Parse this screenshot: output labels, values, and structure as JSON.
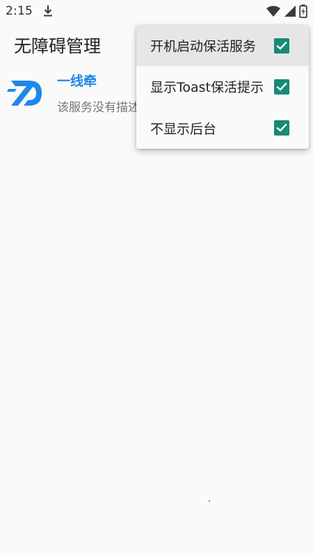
{
  "status_bar": {
    "time": "2:15",
    "icons": [
      "download-icon",
      "wifi-icon",
      "signal-icon",
      "battery-charging-icon"
    ]
  },
  "app_bar": {
    "title": "无障碍管理"
  },
  "service": {
    "name": "一线牵",
    "description": "该服务没有描述"
  },
  "menu": {
    "items": [
      {
        "label": "开机启动保活服务",
        "checked": true
      },
      {
        "label": "显示Toast保活提示",
        "checked": true
      },
      {
        "label": "不显示后台",
        "checked": true
      }
    ]
  },
  "colors": {
    "accent": "#188a76",
    "service_name": "#1e88e5",
    "logo": "#1e88e5"
  }
}
